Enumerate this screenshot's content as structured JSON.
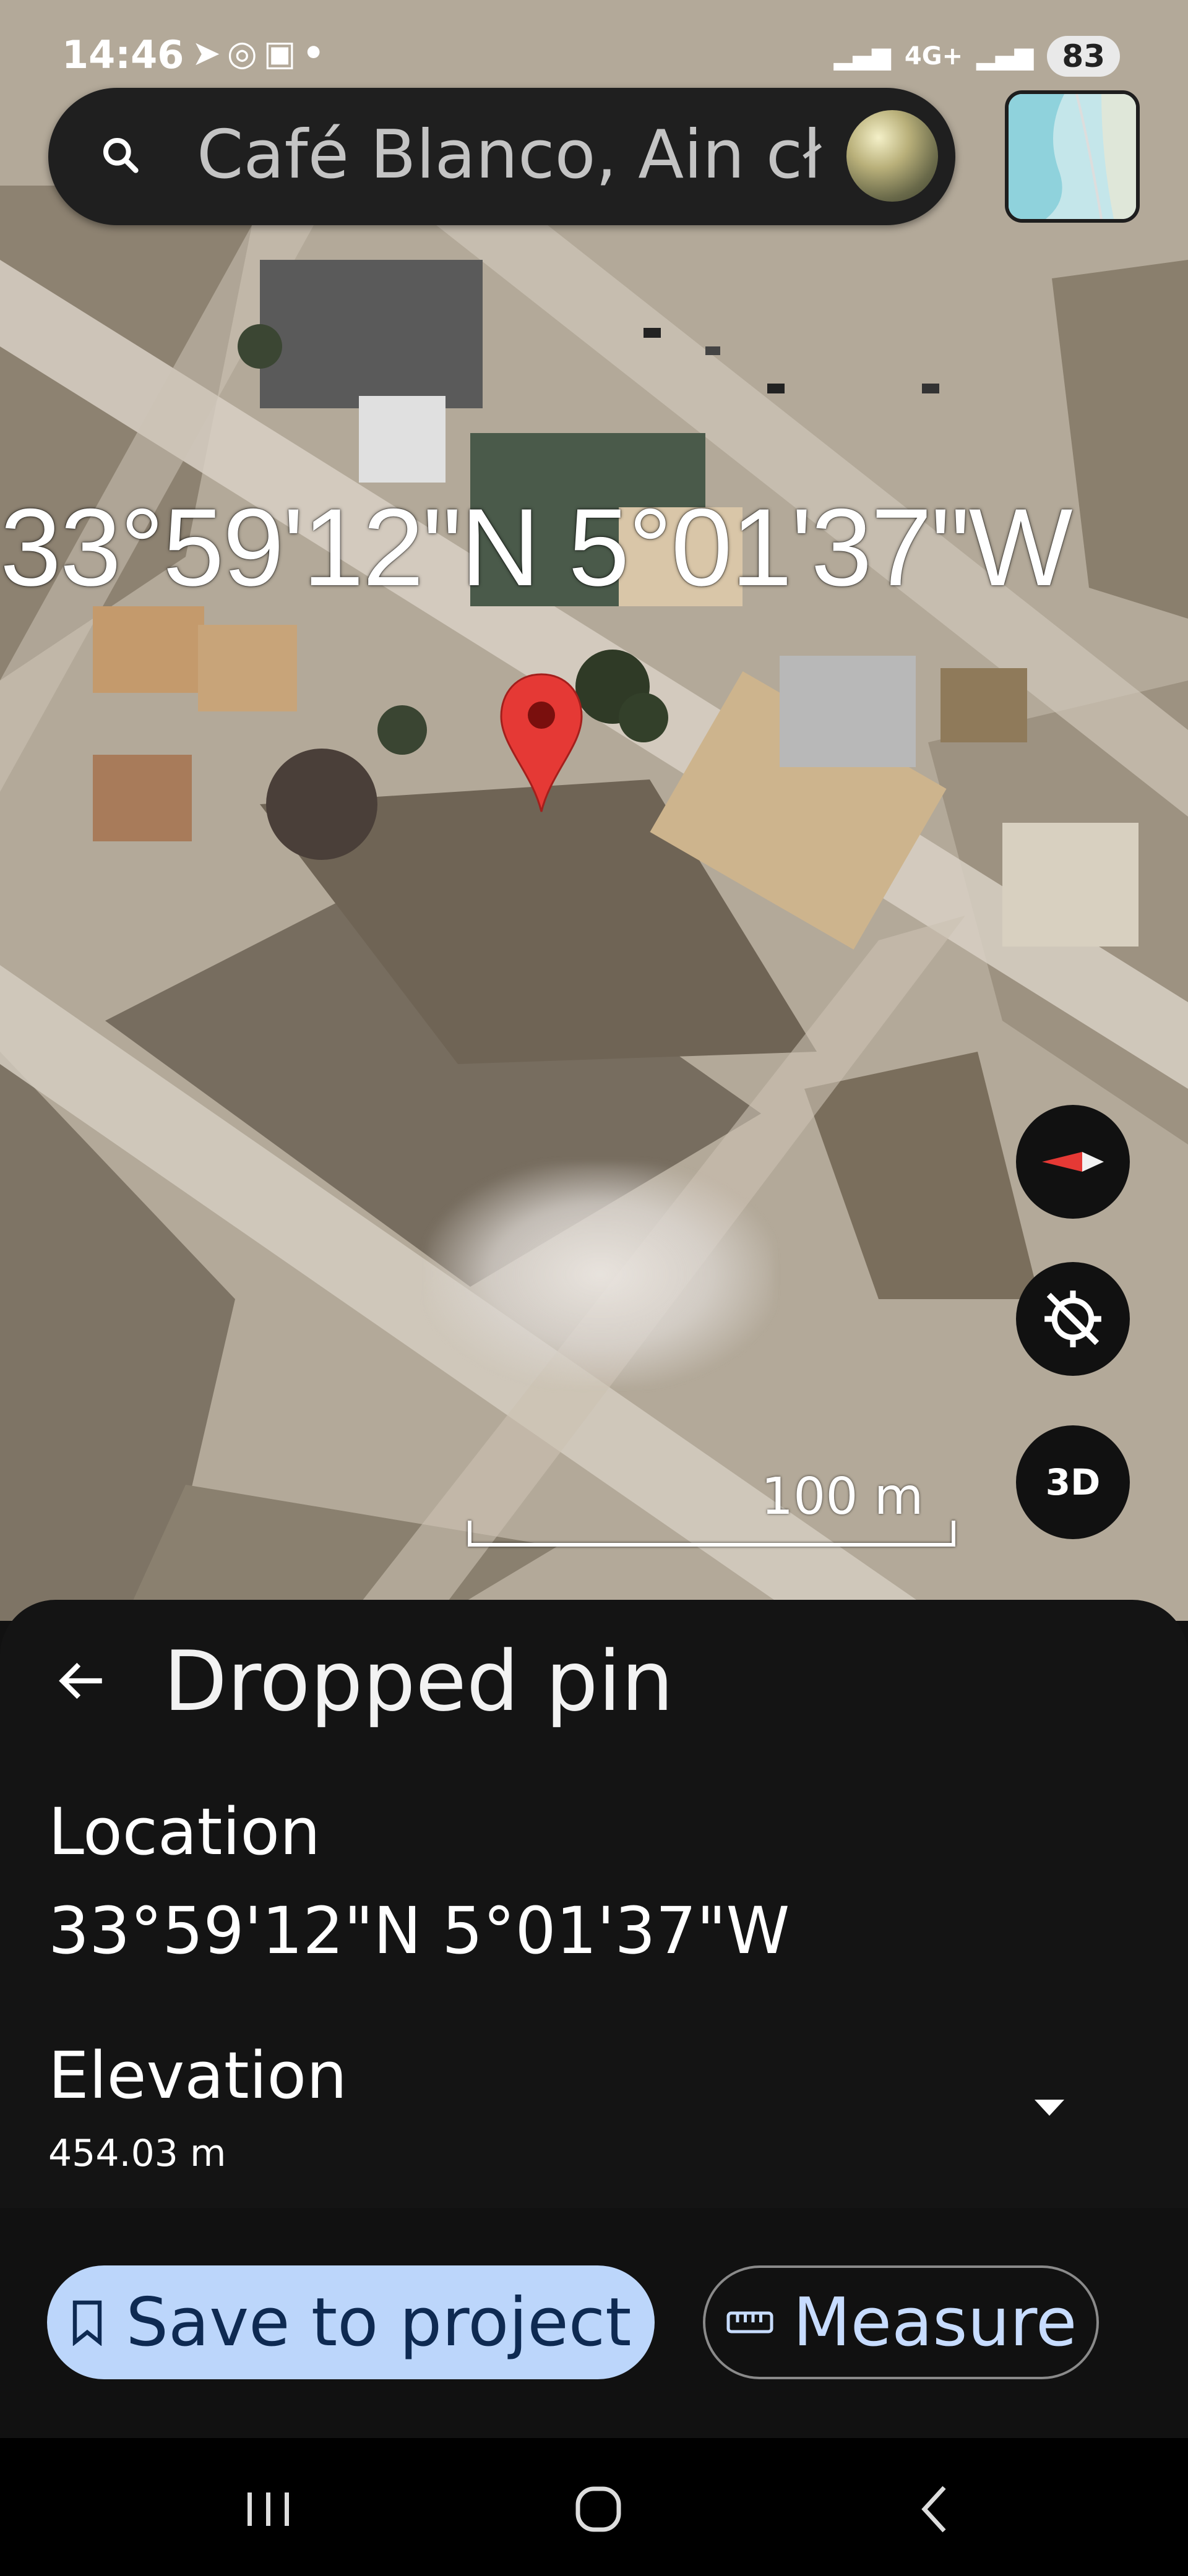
{
  "status_bar": {
    "time": "14:46",
    "notification_icons": [
      "telegram-icon",
      "instagram-icon",
      "linkedin-icon",
      "dot-icon"
    ],
    "network": "4G+",
    "battery": "83"
  },
  "search": {
    "query": "Café Blanco, Ain cł"
  },
  "map": {
    "coordinate_overlay": "33°59'12\"N 5°01'37\"W",
    "scale_label": "100 m",
    "controls": {
      "three_d_label": "3D"
    }
  },
  "sheet": {
    "title": "Dropped pin",
    "location_label": "Location",
    "location_value": "33°59'12\"N 5°01'37\"W",
    "elevation_label": "Elevation",
    "elevation_value": "454.03 m"
  },
  "actions": {
    "save_label": "Save to project",
    "measure_label": "Measure"
  },
  "colors": {
    "accent_button_bg": "#bcd6fb",
    "pin_red": "#e53935",
    "sheet_bg": "#141414"
  }
}
